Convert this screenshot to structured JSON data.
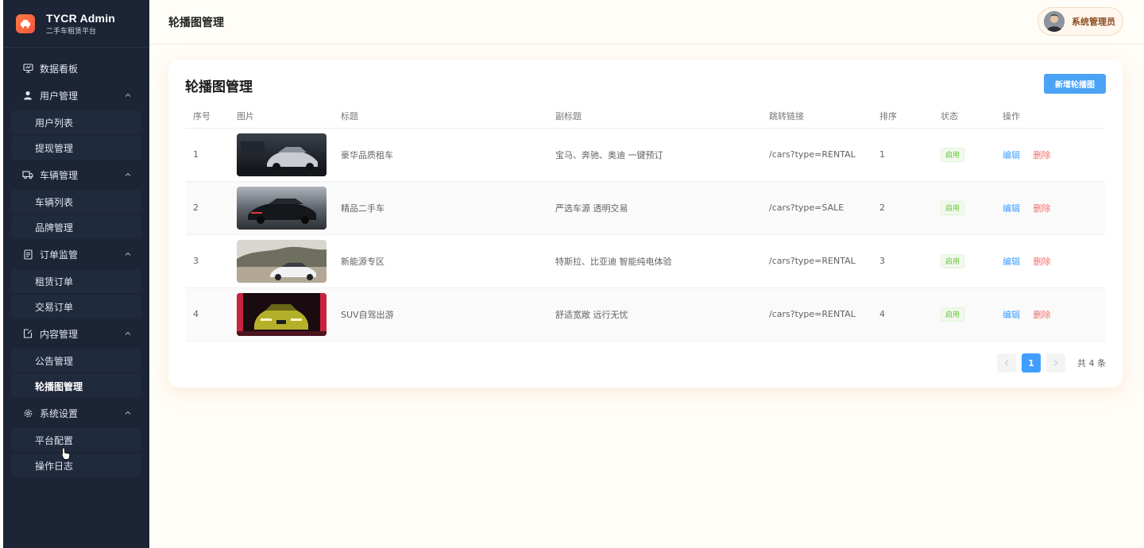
{
  "brand": {
    "title": "TYCR Admin",
    "subtitle": "二手车租赁平台"
  },
  "menu": {
    "dashboard": "数据看板",
    "users": "用户管理",
    "user_list": "用户列表",
    "withdraw": "提现管理",
    "vehicles": "车辆管理",
    "vehicle_list": "车辆列表",
    "brands": "品牌管理",
    "orders": "订单监管",
    "rental_orders": "租赁订单",
    "trade_orders": "交易订单",
    "content": "内容管理",
    "notices": "公告管理",
    "banners": "轮播图管理",
    "settings": "系统设置",
    "platform_config": "平台配置",
    "logs": "操作日志"
  },
  "header": {
    "title": "轮播图管理",
    "user": "系统管理员"
  },
  "card": {
    "title": "轮播图管理",
    "add_label": "新增轮播图"
  },
  "table": {
    "columns": [
      "序号",
      "图片",
      "标题",
      "副标题",
      "跳转链接",
      "排序",
      "状态",
      "操作"
    ],
    "edit_label": "编辑",
    "delete_label": "删除",
    "rows": [
      {
        "index": "1",
        "title": "豪华品质租车",
        "subtitle": "宝马、奔驰、奥迪 一键预订",
        "link": "/cars?type=RENTAL",
        "sort": "1",
        "status": "启用"
      },
      {
        "index": "2",
        "title": "精品二手车",
        "subtitle": "严选车源 透明交易",
        "link": "/cars?type=SALE",
        "sort": "2",
        "status": "启用"
      },
      {
        "index": "3",
        "title": "新能源专区",
        "subtitle": "特斯拉、比亚迪 智能纯电体验",
        "link": "/cars?type=RENTAL",
        "sort": "3",
        "status": "启用"
      },
      {
        "index": "4",
        "title": "SUV自驾出游",
        "subtitle": "舒适宽敞 远行无忧",
        "link": "/cars?type=RENTAL",
        "sort": "4",
        "status": "启用"
      }
    ]
  },
  "pagination": {
    "current": "1",
    "total": "共 4 条"
  },
  "colors": {
    "sidebar": "#1c2435",
    "accent": "#409eff",
    "danger": "#f56c6c",
    "success": "#67c23a"
  }
}
